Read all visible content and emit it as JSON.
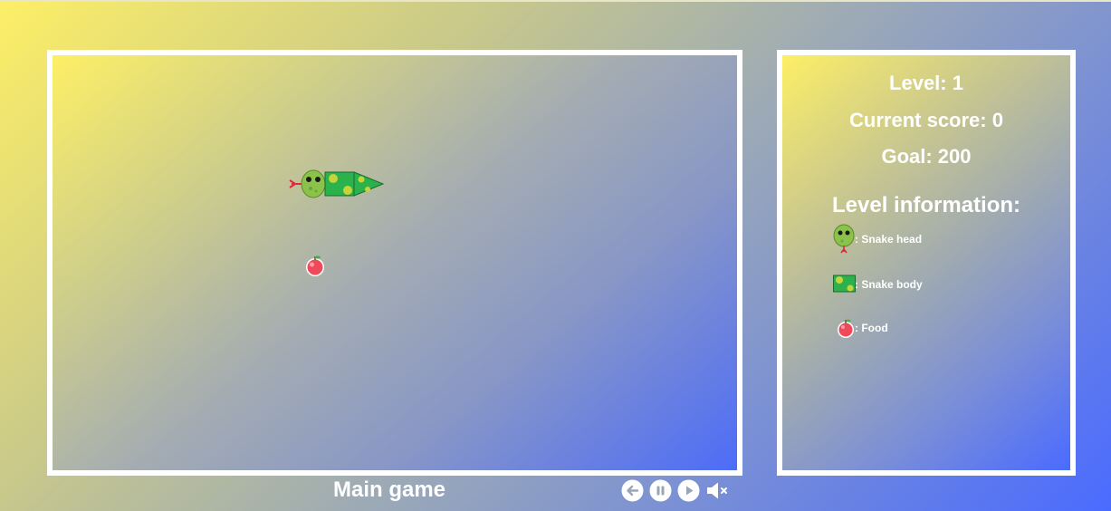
{
  "stats": {
    "level": "Level: 1",
    "score": "Current score: 0",
    "goal": "Goal: 200"
  },
  "info": {
    "title": "Level information:",
    "legend": [
      {
        "icon": "snake-head-icon",
        "label": ": Snake head"
      },
      {
        "icon": "snake-body-icon",
        "label": ": Snake body"
      },
      {
        "icon": "apple-food-icon",
        "label": ": Food"
      }
    ]
  },
  "footer": {
    "title": "Main game"
  },
  "controls": [
    {
      "name": "back-button",
      "icon": "arrow-left-icon"
    },
    {
      "name": "pause-button",
      "icon": "pause-icon"
    },
    {
      "name": "play-button",
      "icon": "play-icon"
    },
    {
      "name": "mute-button",
      "icon": "speaker-muted-icon"
    }
  ],
  "colors": {
    "border": "#ffffff",
    "snake_green": "#2bb24c",
    "snake_head": "#8bc34a",
    "spots": "#c6d43a",
    "food": "#ef4a5a",
    "gradient_start": "#fdef66",
    "gradient_end": "#4a6bff"
  }
}
